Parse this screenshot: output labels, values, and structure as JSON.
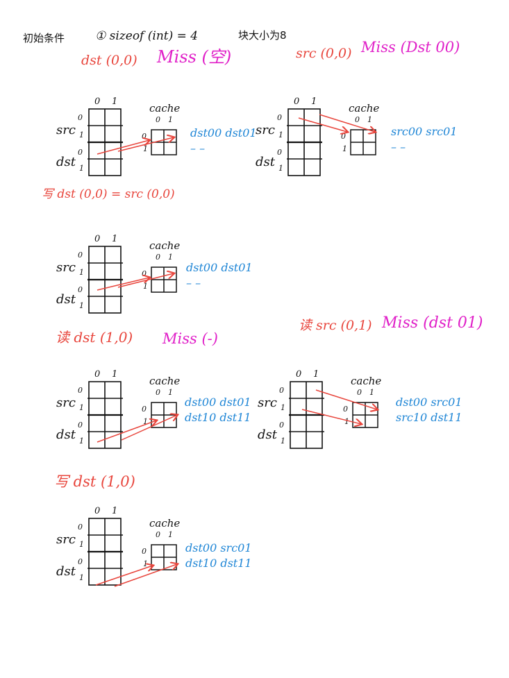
{
  "colors": {
    "ink": "#111111",
    "red": "#e8453c",
    "magenta": "#e020c8",
    "blue": "#1f86d6"
  },
  "header": {
    "conditions": "初始条件",
    "sizeof": "① sizeof (int) = 4",
    "block_size": "块大小为8"
  },
  "notes": {
    "dst00": "dst (0,0)",
    "miss_empty": "Miss (空)",
    "src00": "src (0,0)",
    "miss_dst00": "Miss (Dst 00)",
    "write_dst00": "写  dst (0,0) = src (0,0)",
    "read_dst10": "读  dst (1,0)",
    "miss_dash": "Miss (-)",
    "read_src01": "读  src (0,1)",
    "miss_dst01": "Miss (dst 01)",
    "write_dst10": "写 dst (1,0)"
  },
  "grid_labels": {
    "col0": "0",
    "col1": "1",
    "src": "src",
    "dst": "dst",
    "row0": "0",
    "row1": "1"
  },
  "cache_label": "cache",
  "panels": [
    {
      "cache": [
        "dst00 dst01",
        "–       –"
      ]
    },
    {
      "cache": [
        "src00  src01",
        "–       –"
      ]
    },
    {
      "cache": [
        "dst00  dst01",
        "–       –"
      ]
    },
    {
      "cache": [
        "dst00 dst01",
        "dst10  dst11"
      ]
    },
    {
      "cache": [
        "dst00  src01",
        "src10   dst11"
      ]
    },
    {
      "cache": [
        "dst00  src01",
        "dst10   dst11"
      ]
    }
  ]
}
